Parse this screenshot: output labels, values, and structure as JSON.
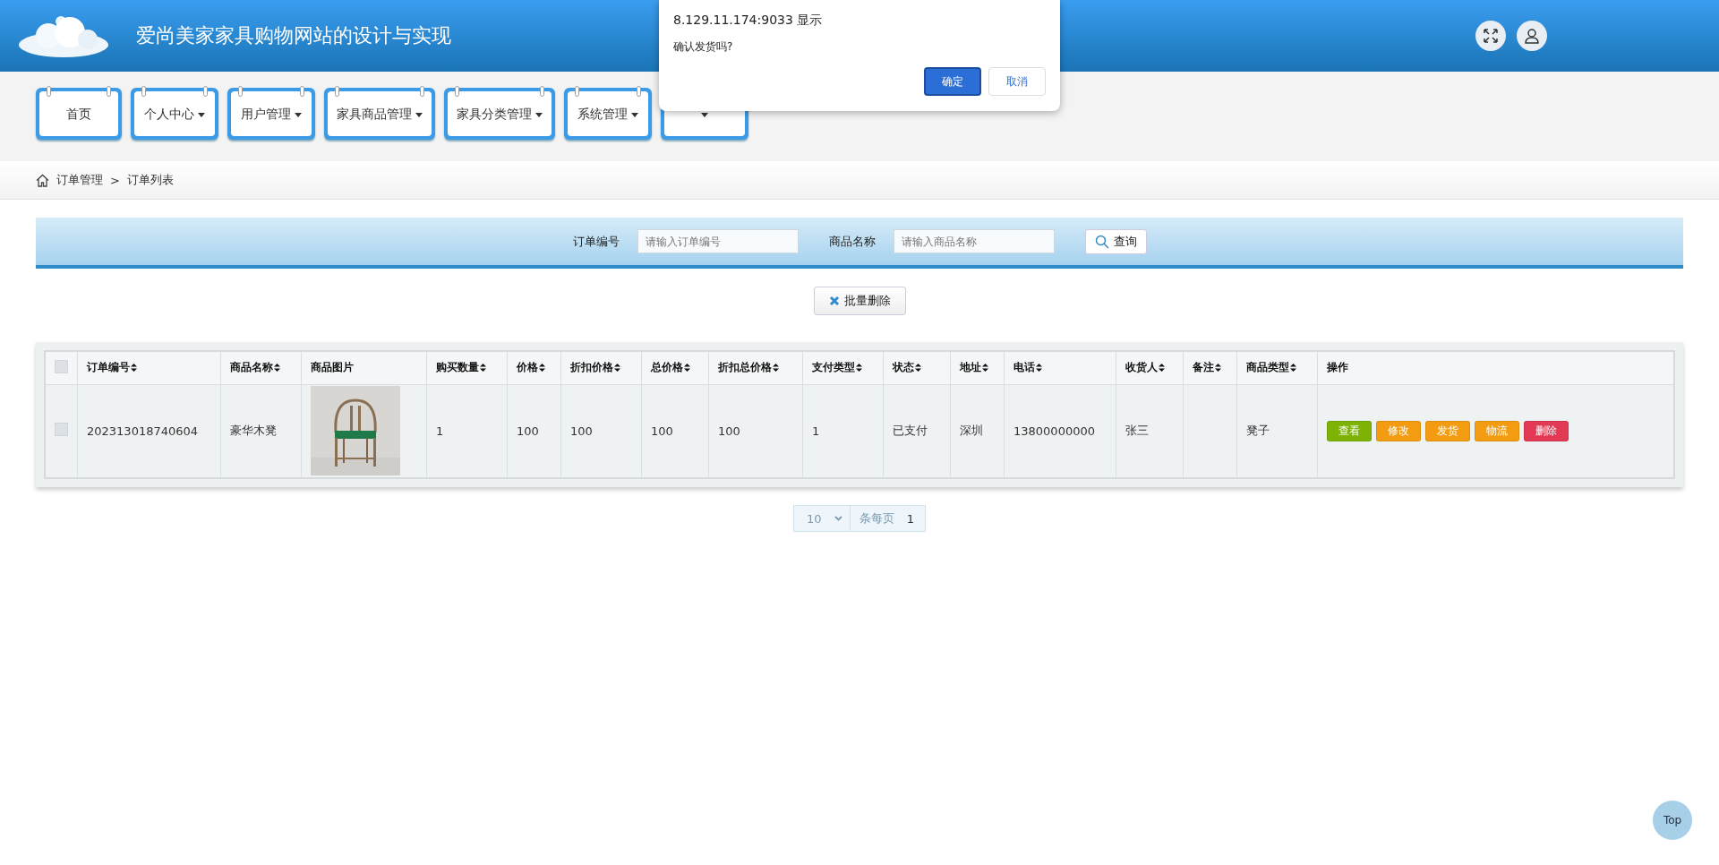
{
  "header": {
    "title": "爱尚美家家具购物网站的设计与实现"
  },
  "nav": [
    {
      "label": "首页",
      "dropdown": false
    },
    {
      "label": "个人中心",
      "dropdown": true
    },
    {
      "label": "用户管理",
      "dropdown": true
    },
    {
      "label": "家具商品管理",
      "dropdown": true
    },
    {
      "label": "家具分类管理",
      "dropdown": true
    },
    {
      "label": "系统管理",
      "dropdown": true
    },
    {
      "dropdown": true
    }
  ],
  "breadcrumb": {
    "items": [
      "订单管理",
      "订单列表"
    ],
    "separator": ">"
  },
  "search": {
    "fields": [
      {
        "label": "订单编号",
        "placeholder": "请输入订单编号"
      },
      {
        "label": "商品名称",
        "placeholder": "请输入商品名称"
      }
    ],
    "button": "查询"
  },
  "batch_delete": "批量删除",
  "table": {
    "select_all_checked": false,
    "columns": [
      {
        "label": "订单编号",
        "sortable": true
      },
      {
        "label": "商品名称",
        "sortable": true
      },
      {
        "label": "商品图片",
        "sortable": false
      },
      {
        "label": "购买数量",
        "sortable": true
      },
      {
        "label": "价格",
        "sortable": true
      },
      {
        "label": "折扣价格",
        "sortable": true
      },
      {
        "label": "总价格",
        "sortable": true
      },
      {
        "label": "折扣总价格",
        "sortable": true
      },
      {
        "label": "支付类型",
        "sortable": true
      },
      {
        "label": "状态",
        "sortable": true
      },
      {
        "label": "地址",
        "sortable": true
      },
      {
        "label": "电话",
        "sortable": true
      },
      {
        "label": "收货人",
        "sortable": true
      },
      {
        "label": "备注",
        "sortable": true
      },
      {
        "label": "商品类型",
        "sortable": true
      },
      {
        "label": "操作",
        "sortable": false
      }
    ],
    "rows": [
      {
        "checked": false,
        "cells": [
          {
            "kind": "text",
            "text": "202313018740604"
          },
          {
            "kind": "text",
            "text": "豪华木凳"
          },
          {
            "kind": "picture"
          },
          {
            "kind": "text",
            "text": "1"
          },
          {
            "kind": "text",
            "text": "100"
          },
          {
            "kind": "text",
            "text": "100"
          },
          {
            "kind": "text",
            "text": "100"
          },
          {
            "kind": "text",
            "text": "100"
          },
          {
            "kind": "text",
            "text": "1"
          },
          {
            "kind": "text",
            "text": "已支付"
          },
          {
            "kind": "text",
            "text": "深圳"
          },
          {
            "kind": "text",
            "text": "13800000000"
          },
          {
            "kind": "text",
            "text": "张三"
          },
          {
            "kind": "blank"
          },
          {
            "kind": "text",
            "text": "凳子"
          }
        ],
        "actions": [
          {
            "label": "查看",
            "color": "#7cb305"
          },
          {
            "label": "修改",
            "color": "#f39c12"
          },
          {
            "label": "发货",
            "color": "#f39c12"
          },
          {
            "label": "物流",
            "color": "#f39c12"
          },
          {
            "label": "删除",
            "color": "#e23a55"
          }
        ]
      }
    ]
  },
  "pagination": {
    "page_size": "10",
    "per_page_label": "条每页",
    "page": "1"
  },
  "top_button": "Top",
  "dialog": {
    "title": "8.129.11.174:9033 显示",
    "message": "确认发货吗?",
    "buttons": [
      {
        "label": "确定",
        "kind": "primary"
      },
      {
        "label": "取消",
        "kind": "secondary"
      }
    ]
  }
}
